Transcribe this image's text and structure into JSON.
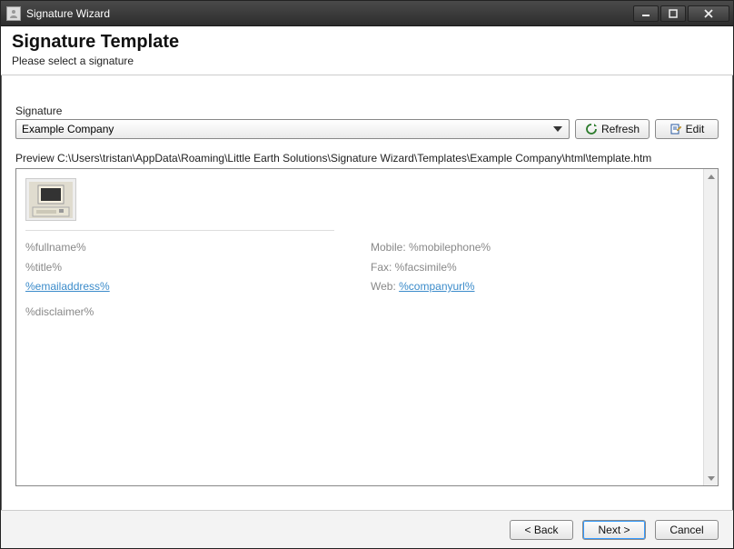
{
  "titlebar": {
    "title": "Signature Wizard"
  },
  "header": {
    "title": "Signature Template",
    "subtitle": "Please select a signature"
  },
  "signature": {
    "label": "Signature",
    "selected": "Example Company",
    "refresh_label": "Refresh",
    "edit_label": "Edit"
  },
  "preview": {
    "label_prefix": "Preview ",
    "path": "C:\\Users\\tristan\\AppData\\Roaming\\Little Earth Solutions\\Signature Wizard\\Templates\\Example Company\\html\\template.htm",
    "fields": {
      "fullname": "%fullname%",
      "title": "%title%",
      "email": "%emailaddress%",
      "disclaimer": "%disclaimer%",
      "mobile_label": "Mobile: ",
      "mobile_value": "%mobilephone%",
      "fax_label": "Fax: ",
      "fax_value": "%facsimile%",
      "web_label": "Web: ",
      "web_value": "%companyurl%"
    }
  },
  "footer": {
    "back": "< Back",
    "next": "Next >",
    "cancel": "Cancel"
  }
}
